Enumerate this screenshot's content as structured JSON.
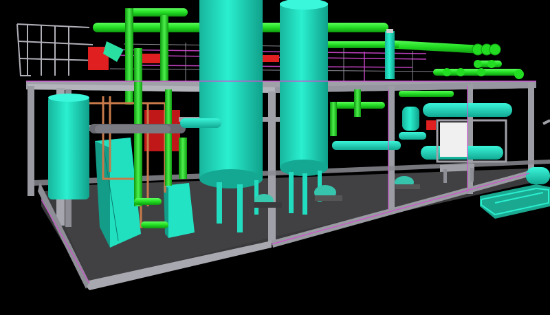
{
  "scene": {
    "colors": {
      "background": "#000000",
      "frame": "#a0a0a8",
      "frame_edge": "#6f6f78",
      "floor": "#3d3d40",
      "vessel": "#24e8c8",
      "vessel_shade": "#12a892",
      "pipe_green": "#22dd22",
      "pipe_green_dark": "#0f9a10",
      "pipe_orange": "#c87a4a",
      "red_block": "#e02020",
      "magenta": "#c040c0",
      "white_panel": "#f0f0f0",
      "pump": "#40c8b0"
    },
    "icons": [
      "tall-vessel",
      "column-vessel",
      "heat-exchanger",
      "pump",
      "plate-exchanger",
      "steel-frame",
      "pipe-rack"
    ]
  }
}
